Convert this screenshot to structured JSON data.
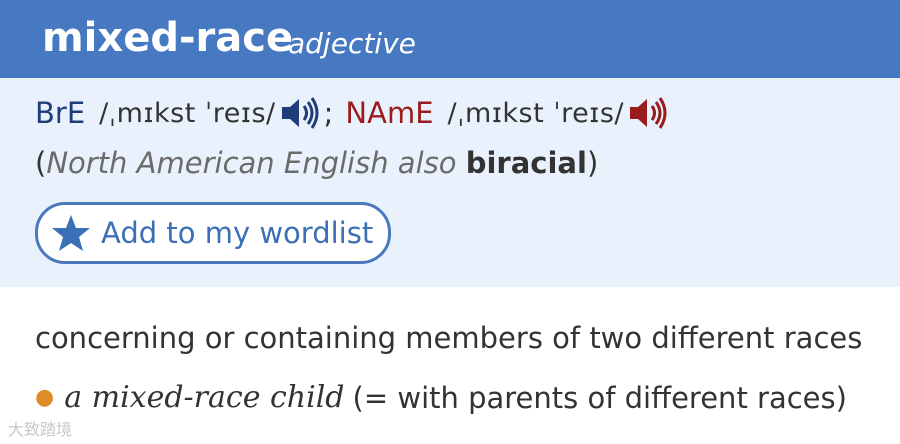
{
  "entry": {
    "headword": "mixed-race",
    "part_of_speech": "adjective"
  },
  "pronunciation": {
    "bre_label": "BrE",
    "bre_ipa": "/ˌmɪkst ˈreɪs/",
    "separator": ";",
    "name_label": "NAmE",
    "name_ipa": "/ˌmɪkst ˈreɪs/",
    "bre_speaker_icon": "speaker-icon",
    "name_speaker_icon": "speaker-icon",
    "bre_color": "#1f3d7a",
    "name_color": "#9a1b1b"
  },
  "variant": {
    "open_paren": "(",
    "region_text": "North American English also",
    "variant_word": "biracial",
    "close_paren": ")"
  },
  "wordlist_button": {
    "label": "Add to my wordlist",
    "icon": "star-icon"
  },
  "sense": {
    "definition": "concerning or containing members of two different races",
    "example_phrase": "a mixed‑race child",
    "example_gloss": "(= with parents of different races)"
  },
  "watermark": {
    "text": "大致踏境"
  },
  "colors": {
    "header_bg": "#4679c1",
    "panel_bg": "#e9f2fc",
    "button_border": "#4a78bd",
    "bullet": "#e08b2a"
  }
}
